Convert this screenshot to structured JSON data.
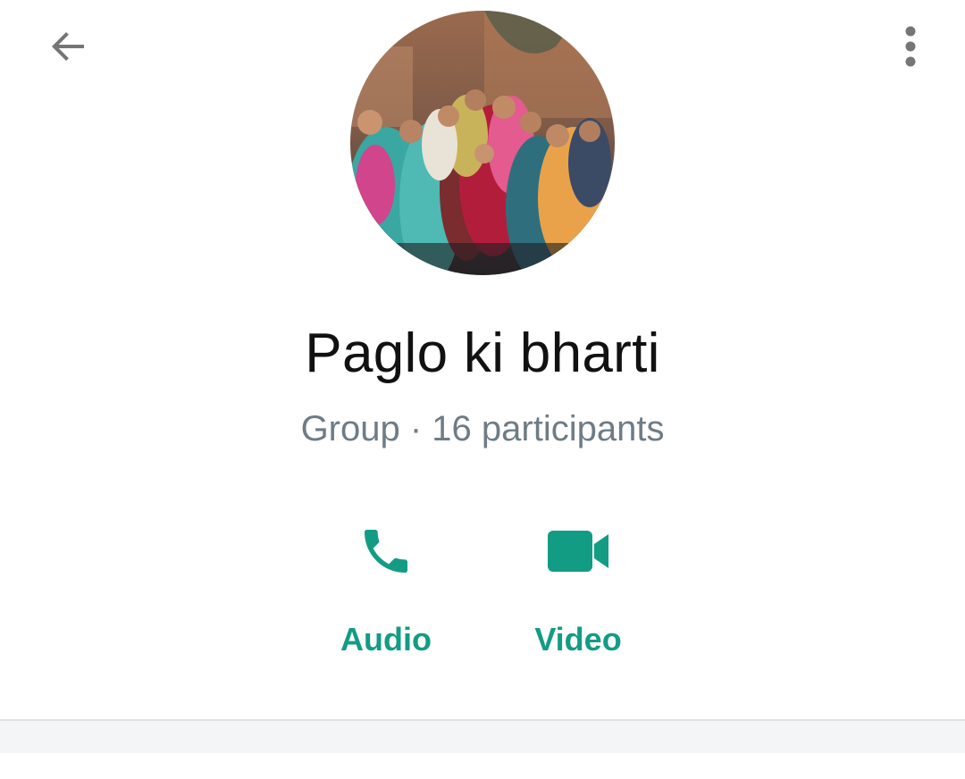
{
  "header": {
    "back_icon": "arrow-left-icon",
    "menu_icon": "more-vertical-icon"
  },
  "profile": {
    "avatar": "group-photo",
    "name": "Paglo ki bharti",
    "meta": "Group · 16 participants"
  },
  "actions": [
    {
      "label": "Audio",
      "icon": "phone-icon"
    },
    {
      "label": "Video",
      "icon": "video-camera-icon"
    }
  ],
  "colors": {
    "accent": "#139c84",
    "icon_gray": "#757575",
    "meta_text": "#6f7c85",
    "title_text": "#111111"
  }
}
